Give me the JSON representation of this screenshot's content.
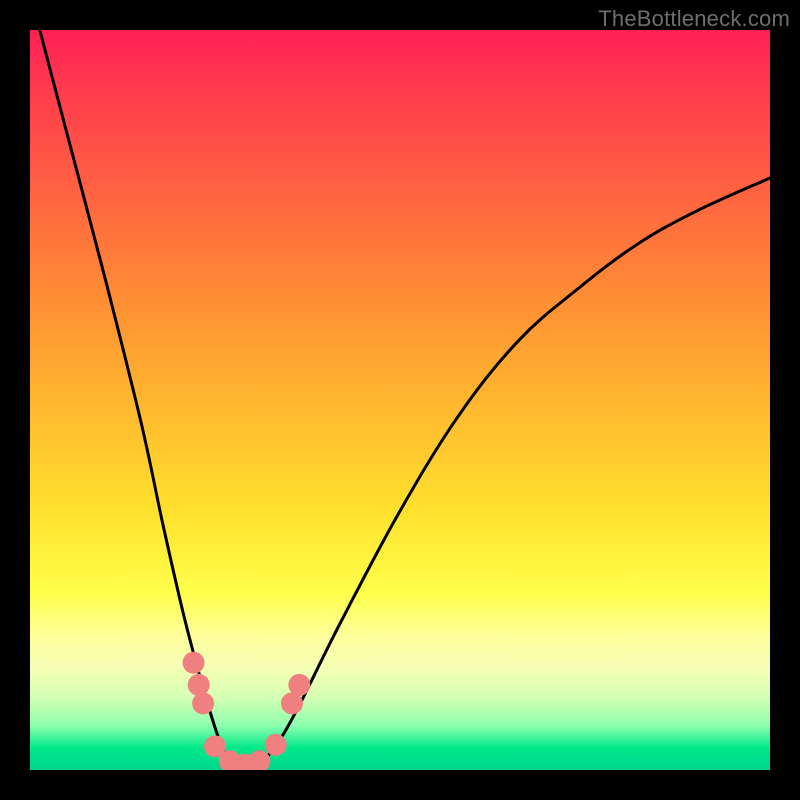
{
  "watermark": "TheBottleneck.com",
  "chart_data": {
    "type": "line",
    "title": "",
    "xlabel": "",
    "ylabel": "",
    "xlim": [
      0,
      100
    ],
    "ylim": [
      0,
      100
    ],
    "series": [
      {
        "name": "bottleneck-curve",
        "x": [
          0,
          5,
          10,
          15,
          18,
          21,
          24,
          26,
          27.5,
          29,
          31,
          33,
          36,
          42,
          50,
          58,
          66,
          74,
          82,
          90,
          100
        ],
        "y": [
          105,
          86,
          67,
          47,
          33,
          20,
          9,
          3,
          1,
          0.5,
          1,
          3,
          8,
          20,
          35,
          48,
          58,
          65,
          71,
          75.5,
          80
        ]
      }
    ],
    "markers": [
      {
        "name": "dot",
        "x": 22.1,
        "y": 14.5
      },
      {
        "name": "dot",
        "x": 22.8,
        "y": 11.5
      },
      {
        "name": "dot",
        "x": 23.4,
        "y": 9.0
      },
      {
        "name": "dot",
        "x": 25.0,
        "y": 3.2
      },
      {
        "name": "dot",
        "x": 27.0,
        "y": 1.2
      },
      {
        "name": "dot",
        "x": 29.0,
        "y": 0.7
      },
      {
        "name": "dot",
        "x": 31.0,
        "y": 1.2
      },
      {
        "name": "dot",
        "x": 33.2,
        "y": 3.4
      },
      {
        "name": "dot",
        "x": 35.4,
        "y": 9.0
      },
      {
        "name": "dot",
        "x": 36.4,
        "y": 11.5
      }
    ],
    "colors": {
      "curve": "#000000",
      "marker": "#f08080",
      "gradient_top": "#ff1f55",
      "gradient_bottom": "#00d48c"
    }
  }
}
